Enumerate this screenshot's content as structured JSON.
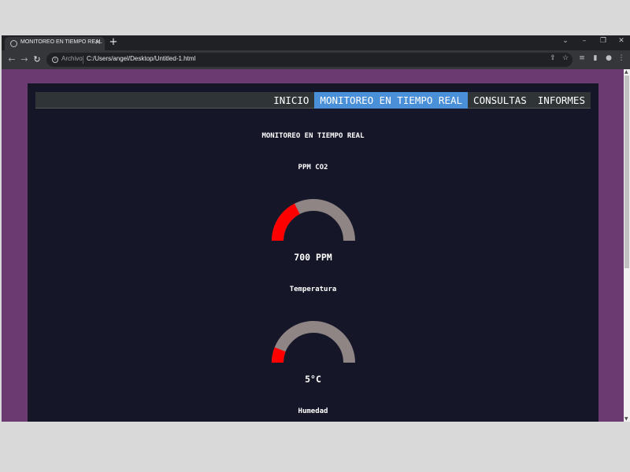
{
  "browser": {
    "tab_title": "MONITOREO EN TIEMPO REAL",
    "tab_close": "×",
    "new_tab": "+",
    "scheme_label": "Archivo",
    "url": "C:/Users/angel/Desktop/Untitled-1.html"
  },
  "nav": {
    "items": [
      {
        "label": "INICIO",
        "active": false
      },
      {
        "label": "MONITOREO EN TIEMPO REAL",
        "active": true
      },
      {
        "label": "CONSULTAS",
        "active": false
      },
      {
        "label": "INFORMES",
        "active": false
      }
    ]
  },
  "page": {
    "title": "MONITOREO EN TIEMPO REAL"
  },
  "gauges": {
    "co2": {
      "title": "PPM CO2",
      "value_text": "700 PPM",
      "fraction": 0.35
    },
    "temperature": {
      "title": "Temperatura",
      "value_text": "5°C",
      "fraction": 0.12
    }
  },
  "humidity": {
    "title": "Humedad"
  },
  "colors": {
    "gauge_fill": "#ff0000",
    "gauge_track": "#8f8585",
    "active_tab": "#4a90d9",
    "page_background": "#6a3a70",
    "panel_background": "#151729"
  }
}
